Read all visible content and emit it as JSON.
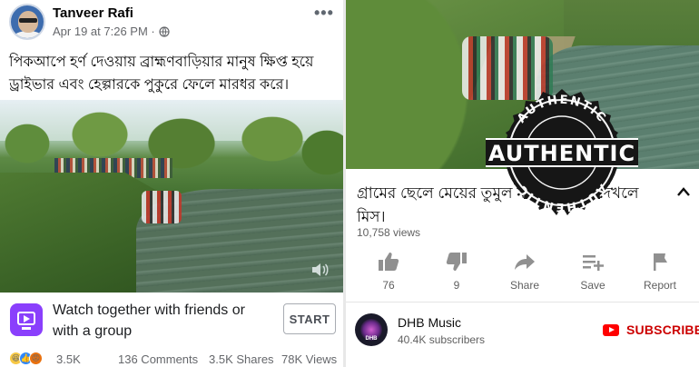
{
  "facebook_post": {
    "author": "Tanveer Rafi",
    "timestamp": "Apr 19 at 7:26 PM · ",
    "text": "পিকআপে হর্ণ দেওয়ায় ব্রাহ্মণবাড়িয়ার মানুষ ক্ষিপ্ত হয়ে ড্রাইভার এবং হেল্পারকে পুকুরে ফেলে মারধর করে।",
    "watch_together": "Watch together with friends or with a group",
    "start_button": "START",
    "reaction_count": "3.5K",
    "comments": "136 Comments",
    "shares": "3.5K Shares",
    "views": "78K Views",
    "icons": [
      "avatar",
      "globe-icon",
      "more-icon",
      "volume-icon",
      "watch-party-icon",
      "haha-reaction",
      "like-reaction",
      "angry-reaction"
    ]
  },
  "youtube": {
    "stamp_text": "AUTHENTIC",
    "title": "গ্রামের ছেলে মেয়ের তুমুল মারামারি। না দেখলে মিস।",
    "views": "10,758 views",
    "actions": {
      "like": "76",
      "dislike": "9",
      "share": "Share",
      "save": "Save",
      "report": "Report"
    },
    "channel": {
      "name": "DHB Music",
      "subscribers": "40.4K subscribers",
      "avatar_text": "DHB"
    },
    "subscribe_label": "SUBSCRIBE",
    "colors": {
      "subscribe": "#cc0000",
      "yt_red": "#ff0000",
      "watch_icon": "#8a3ffc"
    }
  }
}
